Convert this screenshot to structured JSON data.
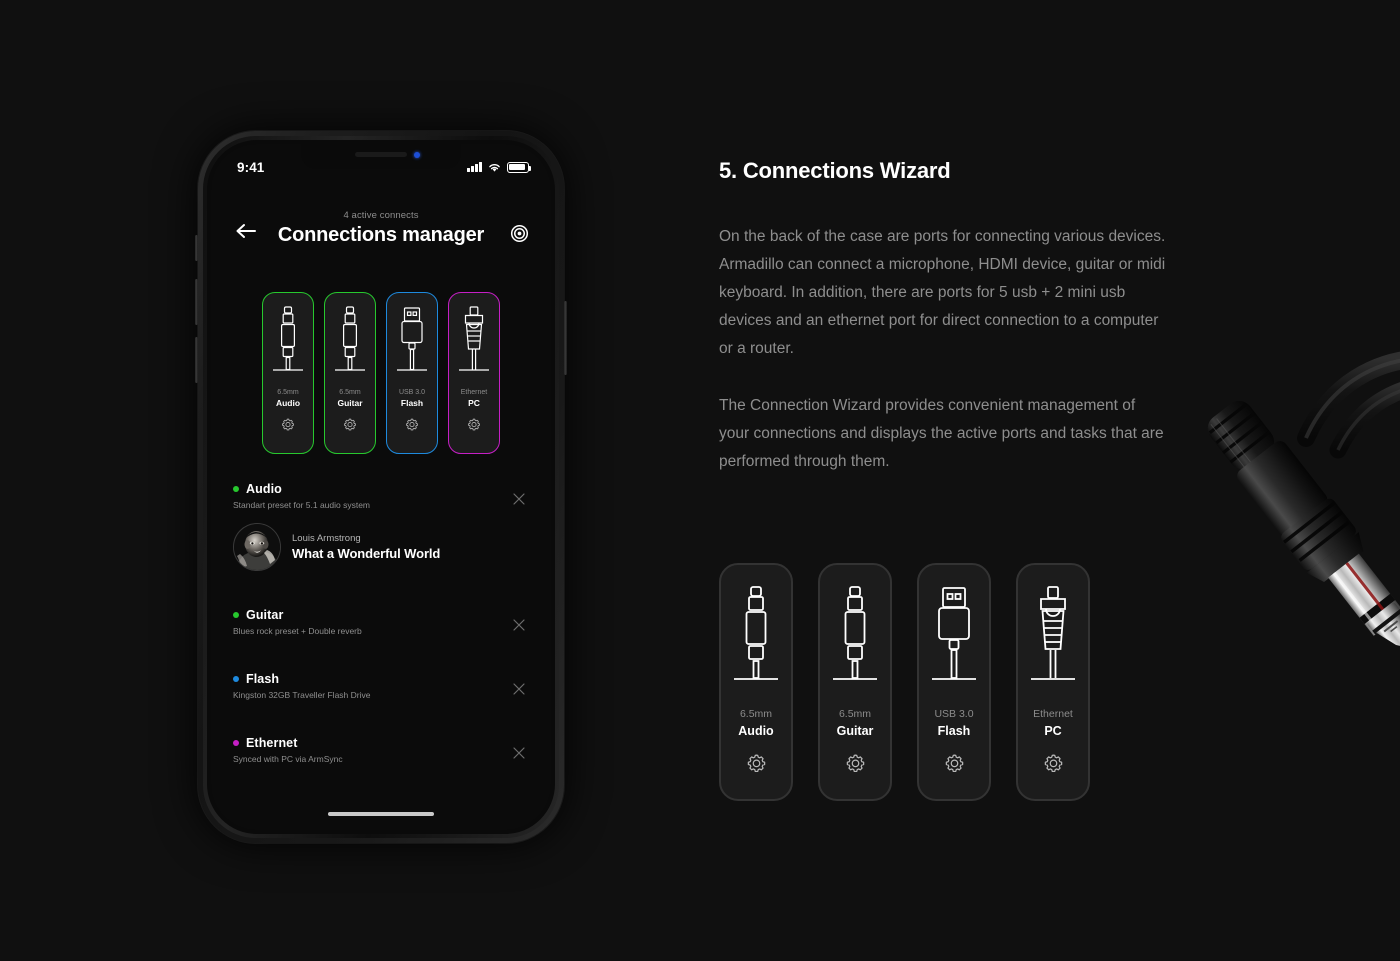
{
  "theme": {
    "background": "#101010",
    "card_fill": "#1c1c1c",
    "green": "#27c82e",
    "blue": "#1e8ade",
    "magenta": "#c61fc6",
    "text_primary": "#ffffff",
    "text_muted": "#8e8e8e"
  },
  "phone": {
    "status_bar": {
      "time": "9:41"
    },
    "header": {
      "subtitle": "4 active connects",
      "title": "Connections manager",
      "back_icon": "arrow-left-icon",
      "settings_icon": "target-icon"
    },
    "ports": [
      {
        "type": "6.5mm",
        "name": "Audio",
        "color": "#27c82e",
        "glyph": "jack-plug-icon",
        "gear": "gear-icon"
      },
      {
        "type": "6.5mm",
        "name": "Guitar",
        "color": "#27c82e",
        "glyph": "jack-plug-icon",
        "gear": "gear-icon"
      },
      {
        "type": "USB 3.0",
        "name": "Flash",
        "color": "#1e8ade",
        "glyph": "usb-plug-icon",
        "gear": "gear-icon"
      },
      {
        "type": "Ethernet",
        "name": "PC",
        "color": "#c61fc6",
        "glyph": "rj45-plug-icon",
        "gear": "gear-icon"
      }
    ],
    "connections": [
      {
        "name": "Audio",
        "desc": "Standart preset for 5.1 audio system",
        "color": "#27c82e",
        "close": "close-icon"
      },
      {
        "name": "Guitar",
        "desc": "Blues rock preset + Double reverb",
        "color": "#27c82e",
        "close": "close-icon"
      },
      {
        "name": "Flash",
        "desc": "Kingston 32GB Traveller Flash Drive",
        "color": "#1e8ade",
        "close": "close-icon"
      },
      {
        "name": "Ethernet",
        "desc": "Synced with PC via ArmSync",
        "color": "#c61fc6",
        "close": "close-icon"
      }
    ],
    "now_playing": {
      "artist": "Louis Armstrong",
      "track": "What a Wonderful World"
    }
  },
  "panel": {
    "title": "5. Connections Wizard",
    "paragraph_1": "On the back of the case are ports for connecting various devices. Armadillo can connect a microphone, HDMI device, guitar or midi keyboard. In addition, there are ports for 5 usb + 2 mini usb devices and an ethernet port for direct connection to a computer or a router.",
    "paragraph_2": "The Connection Wizard provides convenient management of your connections and displays the active ports and tasks that are performed through them.",
    "ports": [
      {
        "type": "6.5mm",
        "name": "Audio",
        "color": "#27c82e",
        "glyph": "jack-plug-icon",
        "gear": "gear-icon"
      },
      {
        "type": "6.5mm",
        "name": "Guitar",
        "color": "#27c82e",
        "glyph": "jack-plug-icon",
        "gear": "gear-icon"
      },
      {
        "type": "USB 3.0",
        "name": "Flash",
        "color": "#1e8ade",
        "glyph": "usb-plug-icon",
        "gear": "gear-icon"
      },
      {
        "type": "Ethernet",
        "name": "PC",
        "color": "#c61fc6",
        "glyph": "rj45-plug-icon",
        "gear": "gear-icon"
      }
    ]
  },
  "decoration": {
    "photo": "audio-jack-cable-photo"
  }
}
